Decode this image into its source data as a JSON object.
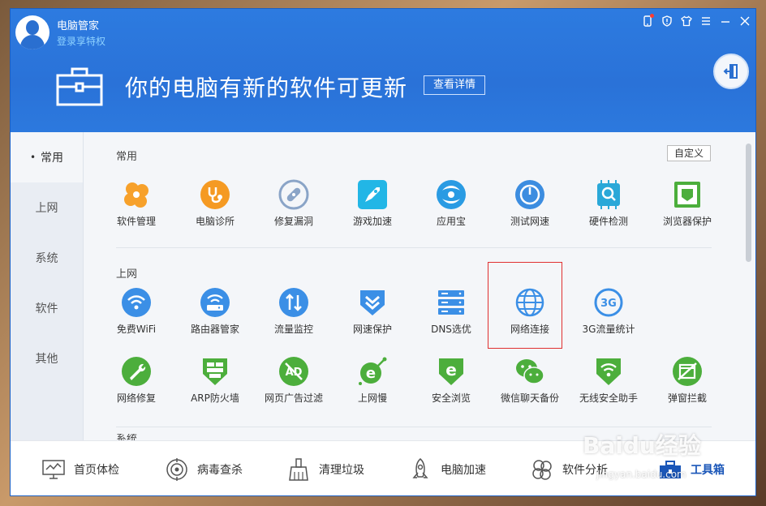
{
  "header": {
    "app_title": "电脑管家",
    "login_link": "登录享特权",
    "banner_title": "你的电脑有新的软件可更新",
    "details_button": "查看详情"
  },
  "sidebar": {
    "items": [
      {
        "label": "常用"
      },
      {
        "label": "上网"
      },
      {
        "label": "系统"
      },
      {
        "label": "软件"
      },
      {
        "label": "其他"
      }
    ]
  },
  "content": {
    "section_common": "常用",
    "section_internet": "上网",
    "section_next_partial": "系统",
    "custom_button": "自定义",
    "common_tools": [
      {
        "label": "软件管理",
        "icon": "clover-icon",
        "color": "#f7a12b"
      },
      {
        "label": "电脑诊所",
        "icon": "stethoscope-icon",
        "color": "#f59a23"
      },
      {
        "label": "修复漏洞",
        "icon": "bandage-icon",
        "color": "#8aa4c7"
      },
      {
        "label": "游戏加速",
        "icon": "rocket-icon",
        "color": "#22b6e6"
      },
      {
        "label": "应用宝",
        "icon": "yingyongbao-icon",
        "color": "#2a9be3"
      },
      {
        "label": "测试网速",
        "icon": "gauge-icon",
        "color": "#3c8de0"
      },
      {
        "label": "硬件检测",
        "icon": "chip-icon",
        "color": "#2aa8d8"
      },
      {
        "label": "浏览器保护",
        "icon": "browser-shield-icon",
        "color": "#4cae3c"
      }
    ],
    "internet_tools_row1": [
      {
        "label": "免费WiFi",
        "icon": "wifi-icon",
        "color": "#3b8fe6"
      },
      {
        "label": "路由器管家",
        "icon": "router-icon",
        "color": "#3b8fe6"
      },
      {
        "label": "流量监控",
        "icon": "traffic-arrows-icon",
        "color": "#3b8fe6"
      },
      {
        "label": "网速保护",
        "icon": "shield-chevron-icon",
        "color": "#3b8fe6"
      },
      {
        "label": "DNS选优",
        "icon": "server-icon",
        "color": "#3b8fe6"
      },
      {
        "label": "网络连接",
        "icon": "globe-icon",
        "color": "#3b8fe6"
      },
      {
        "label": "3G流量统计",
        "icon": "3g-icon",
        "color": "#3b8fe6"
      }
    ],
    "internet_tools_row2": [
      {
        "label": "网络修复",
        "icon": "wrench-icon",
        "color": "#4cae3c"
      },
      {
        "label": "ARP防火墙",
        "icon": "firewall-icon",
        "color": "#4cae3c"
      },
      {
        "label": "网页广告过滤",
        "icon": "ad-block-icon",
        "color": "#4cae3c"
      },
      {
        "label": "上网慢",
        "icon": "ie-icon",
        "color": "#4cae3c"
      },
      {
        "label": "安全浏览",
        "icon": "shield-e-icon",
        "color": "#4cae3c"
      },
      {
        "label": "微信聊天备份",
        "icon": "wechat-icon",
        "color": "#4cae3c"
      },
      {
        "label": "无线安全助手",
        "icon": "wifi-shield-icon",
        "color": "#4cae3c"
      },
      {
        "label": "弹窗拦截",
        "icon": "popup-block-icon",
        "color": "#4cae3c"
      }
    ]
  },
  "bottom_nav": [
    {
      "label": "首页体检",
      "icon": "monitor-icon"
    },
    {
      "label": "病毒查杀",
      "icon": "virus-scan-icon"
    },
    {
      "label": "清理垃圾",
      "icon": "broom-icon"
    },
    {
      "label": "电脑加速",
      "icon": "rocket-icon"
    },
    {
      "label": "软件分析",
      "icon": "clover-icon"
    },
    {
      "label": "工具箱",
      "icon": "toolbox-icon"
    }
  ],
  "watermark": {
    "main": "Baidu经验",
    "sub": "jingyan.baidu.com"
  }
}
